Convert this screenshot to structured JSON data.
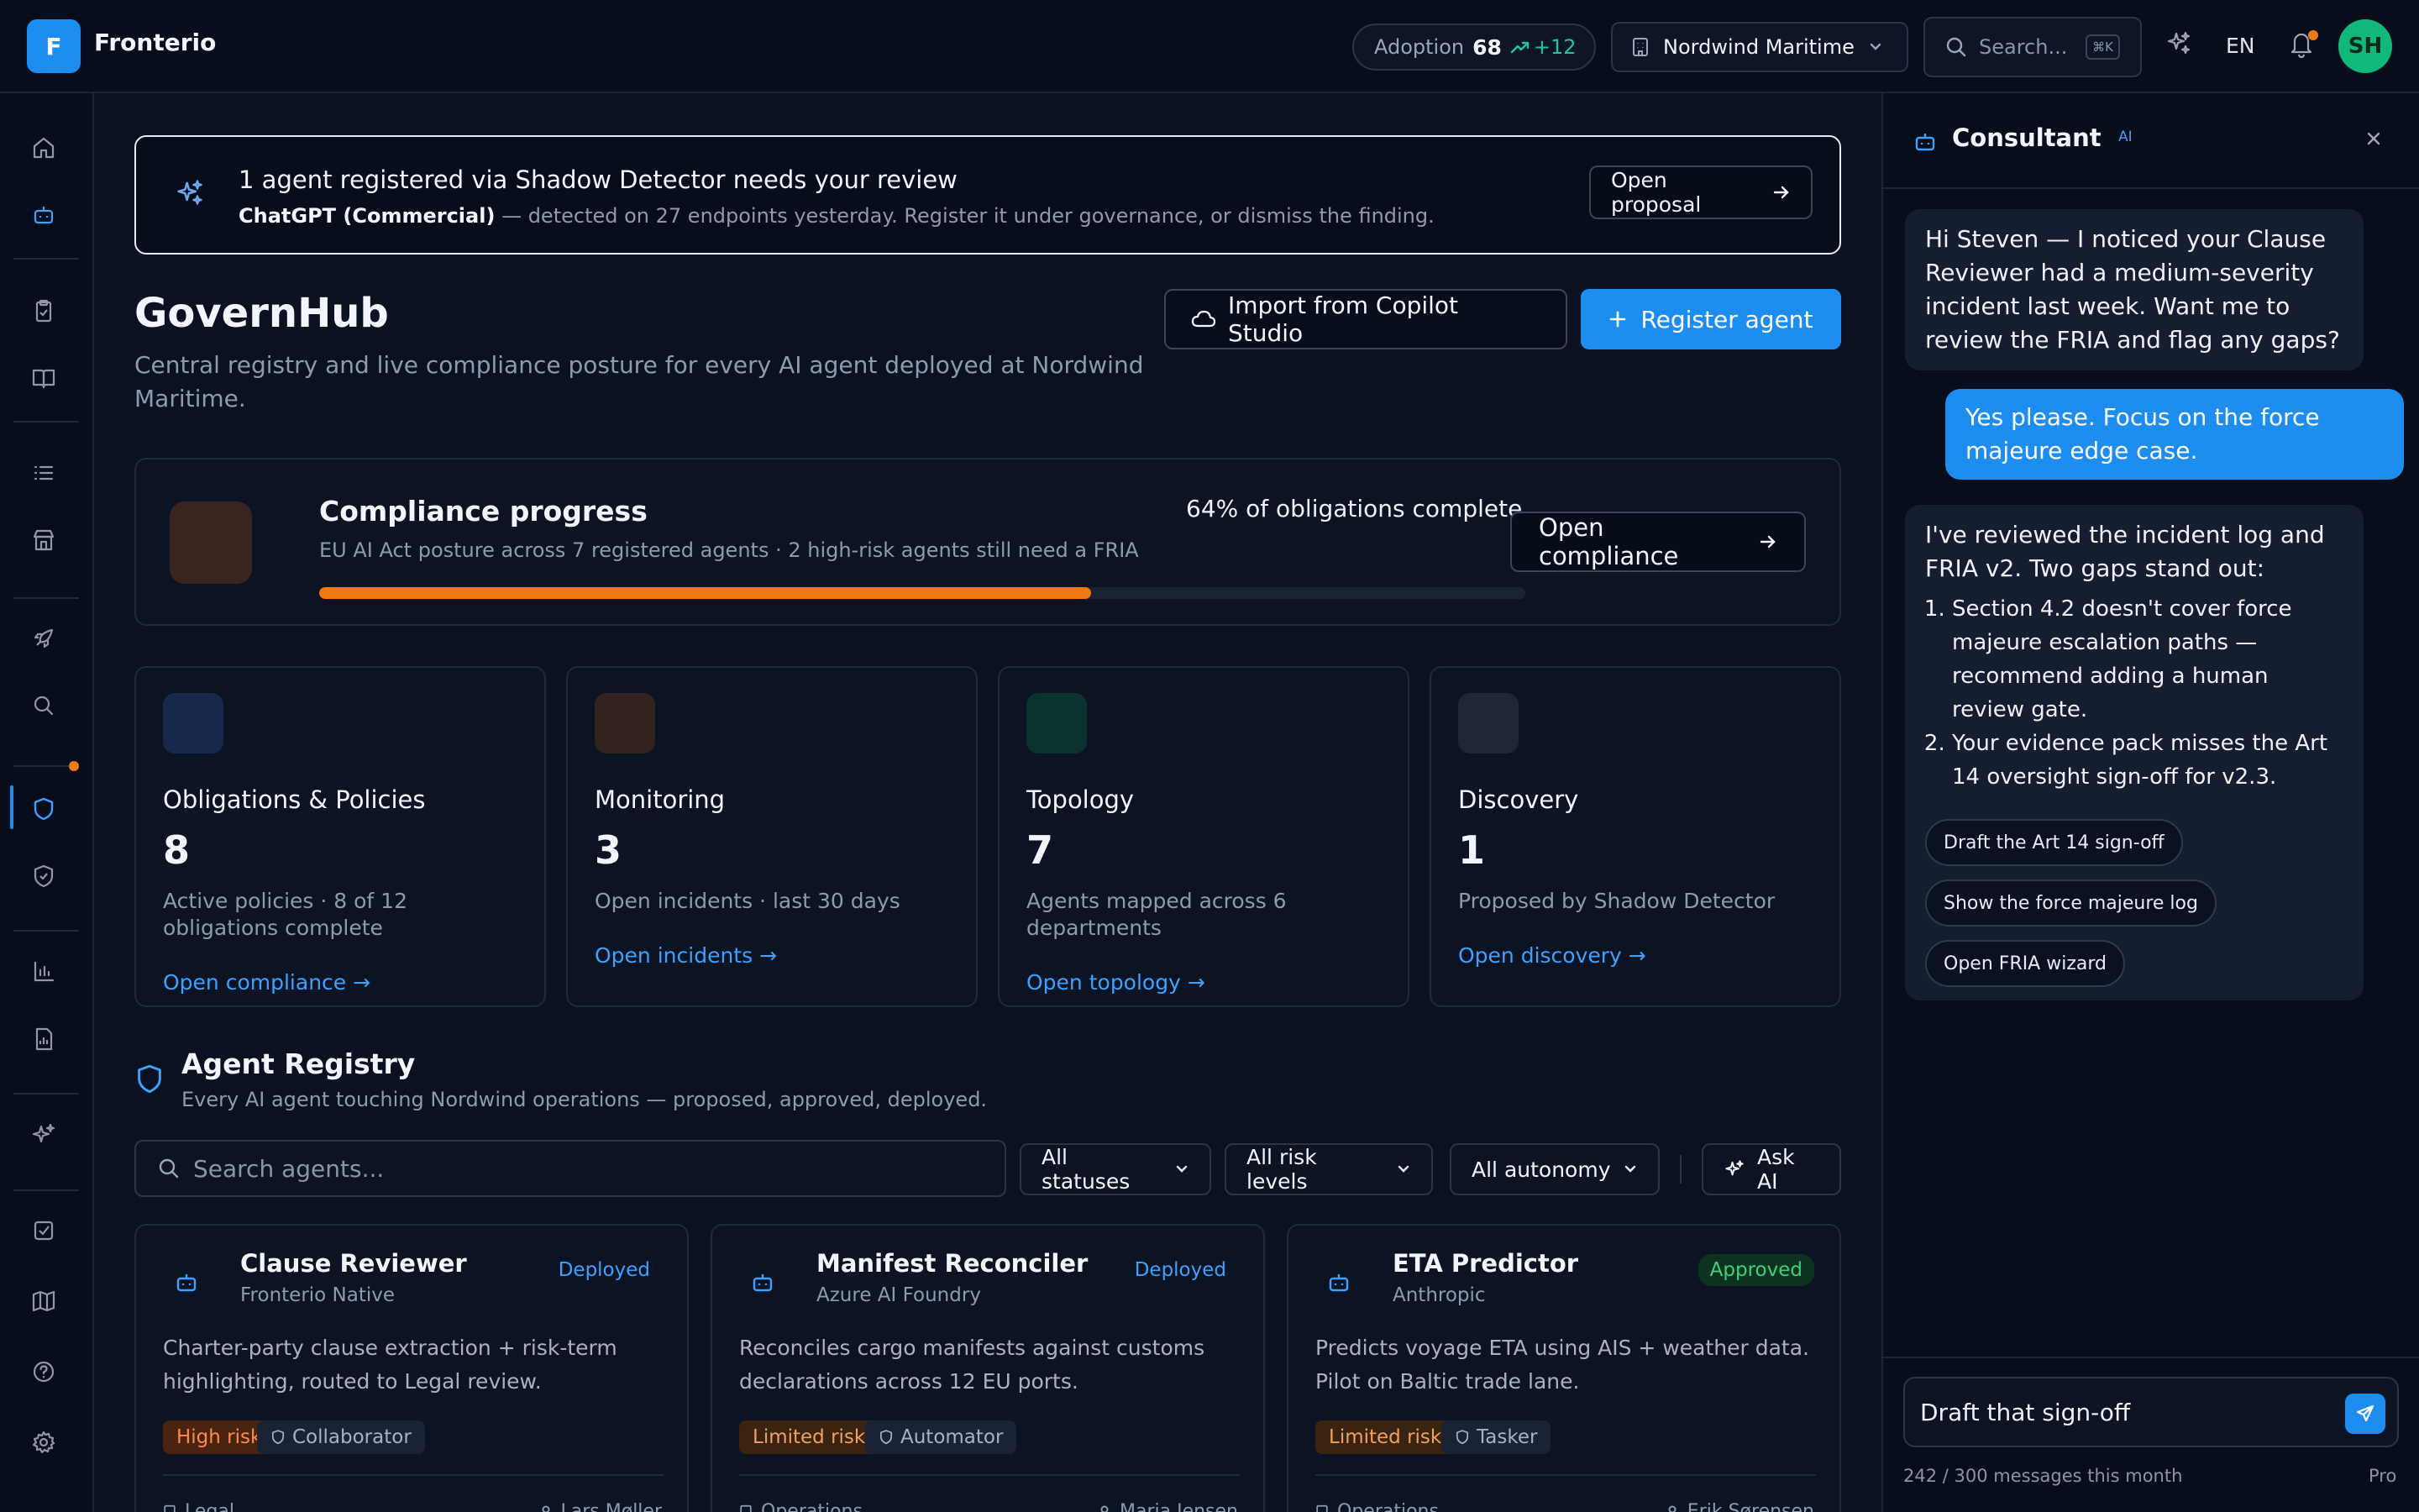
{
  "topbar": {
    "logo_letter": "F",
    "app_name": "Fronterio",
    "adoption_label": "Adoption",
    "adoption_value": "68",
    "adoption_trend": "+12",
    "org_name": "Nordwind Maritime",
    "search_placeholder": "Search...",
    "search_shortcut": "⌘K",
    "language": "EN",
    "user_initials": "SH"
  },
  "banner": {
    "title": "1 agent registered via Shadow Detector needs your review",
    "agent": "ChatGPT (Commercial)",
    "detail": " — detected on 27 endpoints yesterday. Register it under governance, or dismiss the finding.",
    "button": "Open proposal"
  },
  "page": {
    "title": "GovernHub",
    "subtitle": "Central registry and live compliance posture for every AI agent deployed at Nordwind Maritime.",
    "import_button": "Import from Copilot Studio",
    "register_button": "Register agent"
  },
  "compliance": {
    "title": "Compliance progress",
    "subtitle": "EU AI Act posture across 7 registered agents · 2 high-risk agents still need a FRIA",
    "percent_text": "64% of obligations complete",
    "progress": 0.64,
    "button": "Open compliance"
  },
  "stats": [
    {
      "title": "Obligations & Policies",
      "value": "8",
      "desc": "Active policies · 8 of 12 obligations complete",
      "link": "Open compliance →",
      "color": "#16294a"
    },
    {
      "title": "Monitoring",
      "value": "3",
      "desc": "Open incidents · last 30 days",
      "link": "Open incidents →",
      "color": "#33231f"
    },
    {
      "title": "Topology",
      "value": "7",
      "desc": "Agents mapped across 6 departments",
      "link": "Open topology →",
      "color": "#0a3330"
    },
    {
      "title": "Discovery",
      "value": "1",
      "desc": "Proposed by Shadow Detector",
      "link": "Open discovery →",
      "color": "#1e2638"
    }
  ],
  "registry": {
    "title": "Agent Registry",
    "subtitle": "Every AI agent touching Nordwind operations — proposed, approved, deployed.",
    "search_placeholder": "Search agents...",
    "filters": [
      "All statuses",
      "All risk levels",
      "All autonomy"
    ],
    "ask_ai": "Ask AI"
  },
  "agents": [
    {
      "name": "Clause Reviewer",
      "provider": "Fronterio Native",
      "status": "Deployed",
      "desc": "Charter-party clause extraction + risk-term highlighting, routed to Legal review.",
      "risk": "High risk",
      "autonomy": "Collaborator",
      "dept": "Legal",
      "owner": "Lars Møller"
    },
    {
      "name": "Manifest Reconciler",
      "provider": "Azure AI Foundry",
      "status": "Deployed",
      "desc": "Reconciles cargo manifests against customs declarations across 12 EU ports.",
      "risk": "Limited risk",
      "autonomy": "Automator",
      "dept": "Operations",
      "owner": "Maria Jensen"
    },
    {
      "name": "ETA Predictor",
      "provider": "Anthropic",
      "status": "Approved",
      "desc": "Predicts voyage ETA using AIS + weather data. Pilot on Baltic trade lane.",
      "risk": "Limited risk",
      "autonomy": "Tasker",
      "dept": "Operations",
      "owner": "Erik Sørensen"
    }
  ],
  "consultant": {
    "title": "Consultant",
    "badge": "AI",
    "msg1": "Hi Steven — I noticed your Clause Reviewer had a medium-severity incident last week. Want me to review the FRIA and flag any gaps?",
    "msg2": "Yes please. Focus on the force majeure edge case.",
    "msg3_intro": "I've reviewed the incident log and FRIA v2. Two gaps stand out:",
    "msg3_items": [
      "Section 4.2 doesn't cover force majeure escalation paths — recommend adding a human review gate.",
      "Your evidence pack misses the Art 14 oversight sign-off for v2.3."
    ],
    "chips": [
      "Draft the Art 14 sign-off",
      "Show the force majeure log",
      "Open FRIA wizard"
    ],
    "input_value": "Draft that sign-off",
    "usage": "242 / 300 messages this month",
    "plan": "Pro"
  }
}
